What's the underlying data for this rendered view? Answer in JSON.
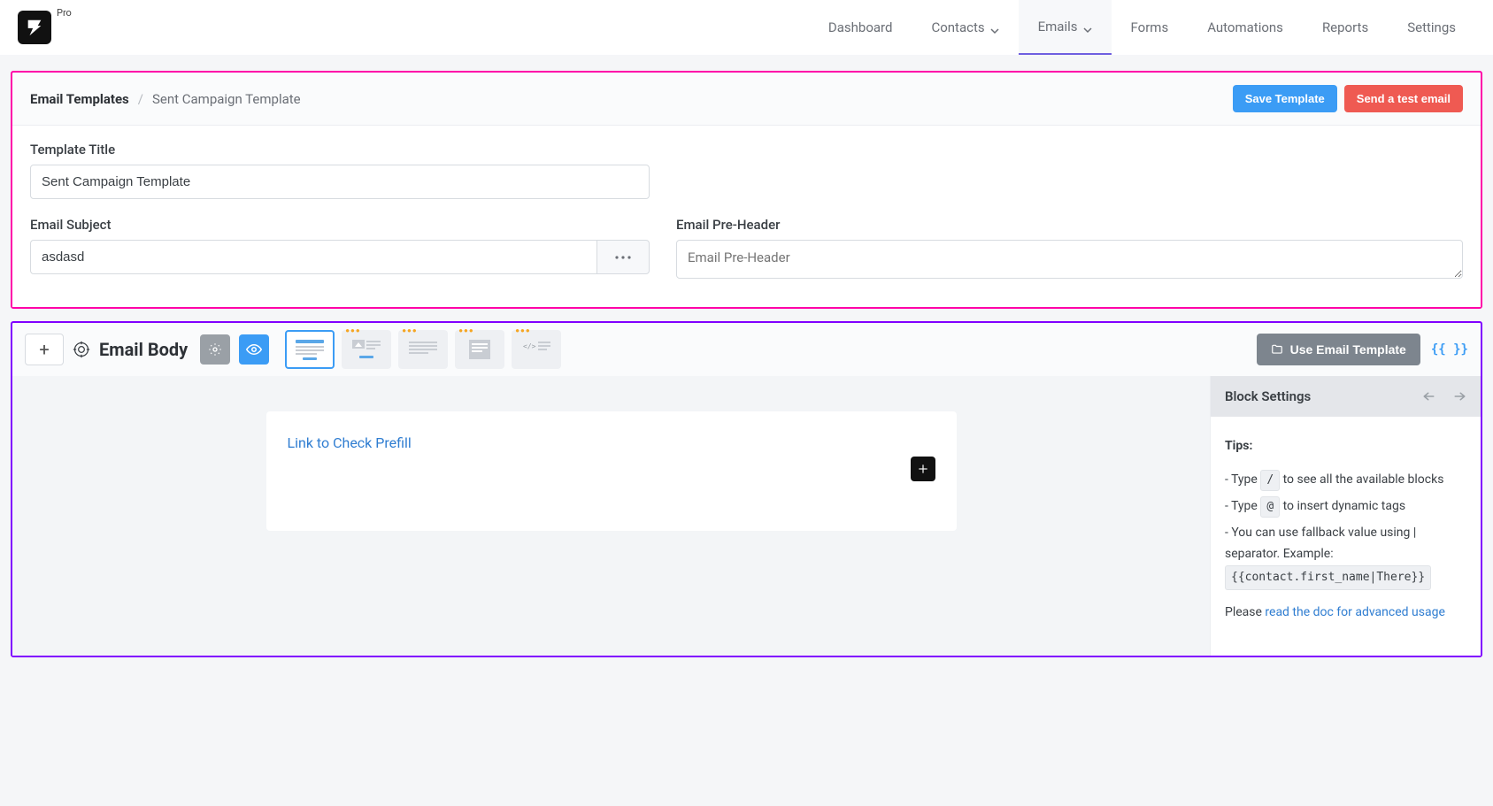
{
  "brand": {
    "pro_label": "Pro"
  },
  "nav": {
    "items": [
      {
        "label": "Dashboard",
        "has_chevron": false,
        "active": false
      },
      {
        "label": "Contacts",
        "has_chevron": true,
        "active": false
      },
      {
        "label": "Emails",
        "has_chevron": true,
        "active": true
      },
      {
        "label": "Forms",
        "has_chevron": false,
        "active": false
      },
      {
        "label": "Automations",
        "has_chevron": false,
        "active": false
      },
      {
        "label": "Reports",
        "has_chevron": false,
        "active": false
      },
      {
        "label": "Settings",
        "has_chevron": false,
        "active": false
      }
    ]
  },
  "breadcrumb": {
    "root": "Email Templates",
    "leaf": "Sent Campaign Template"
  },
  "actions": {
    "save_label": "Save Template",
    "send_test_label": "Send a test email"
  },
  "fields": {
    "title_label": "Template Title",
    "title_value": "Sent Campaign Template",
    "subject_label": "Email Subject",
    "subject_value": "asdasd",
    "preheader_label": "Email Pre-Header",
    "preheader_placeholder": "Email Pre-Header",
    "preheader_value": ""
  },
  "body_toolbar": {
    "title": "Email Body",
    "use_template_label": "Use Email Template",
    "brackets_label": "{{ }}"
  },
  "canvas": {
    "link_text": "Link to Check Prefill"
  },
  "settings": {
    "header": "Block Settings",
    "tips_title": "Tips:",
    "tip1_prefix": "- Type ",
    "tip1_key": "/",
    "tip1_suffix": " to see all the available blocks",
    "tip2_prefix": "- Type ",
    "tip2_key": "@",
    "tip2_suffix": " to insert dynamic tags",
    "tip3_text": "- You can use fallback value using | separator. Example:",
    "tip3_code": "{{contact.first_name|There}}",
    "doc_prefix": "Please ",
    "doc_link": "read the doc for advanced usage"
  }
}
